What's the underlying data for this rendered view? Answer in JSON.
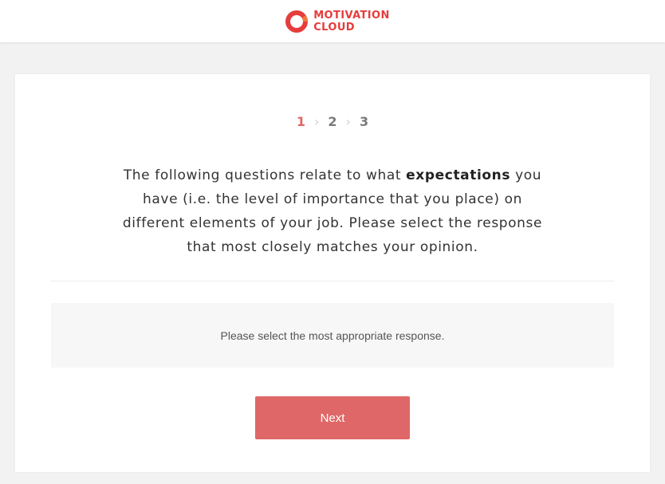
{
  "header": {
    "logo_line1": "MOTIVATION",
    "logo_line2": "CLOUD",
    "brand_color": "#e63c3c"
  },
  "steps": {
    "items": [
      "1",
      "2",
      "3"
    ],
    "active": "1"
  },
  "intro": {
    "before": "The following questions relate to what ",
    "emphasis": "expectations",
    "after": " you have (i.e. the level of importance that you place) on different elements of your job. Please select the response that most closely matches your opinion."
  },
  "question": {
    "prompt": "Please select the most appropriate response."
  },
  "actions": {
    "next_label": "Next",
    "button_color": "#e06767"
  }
}
